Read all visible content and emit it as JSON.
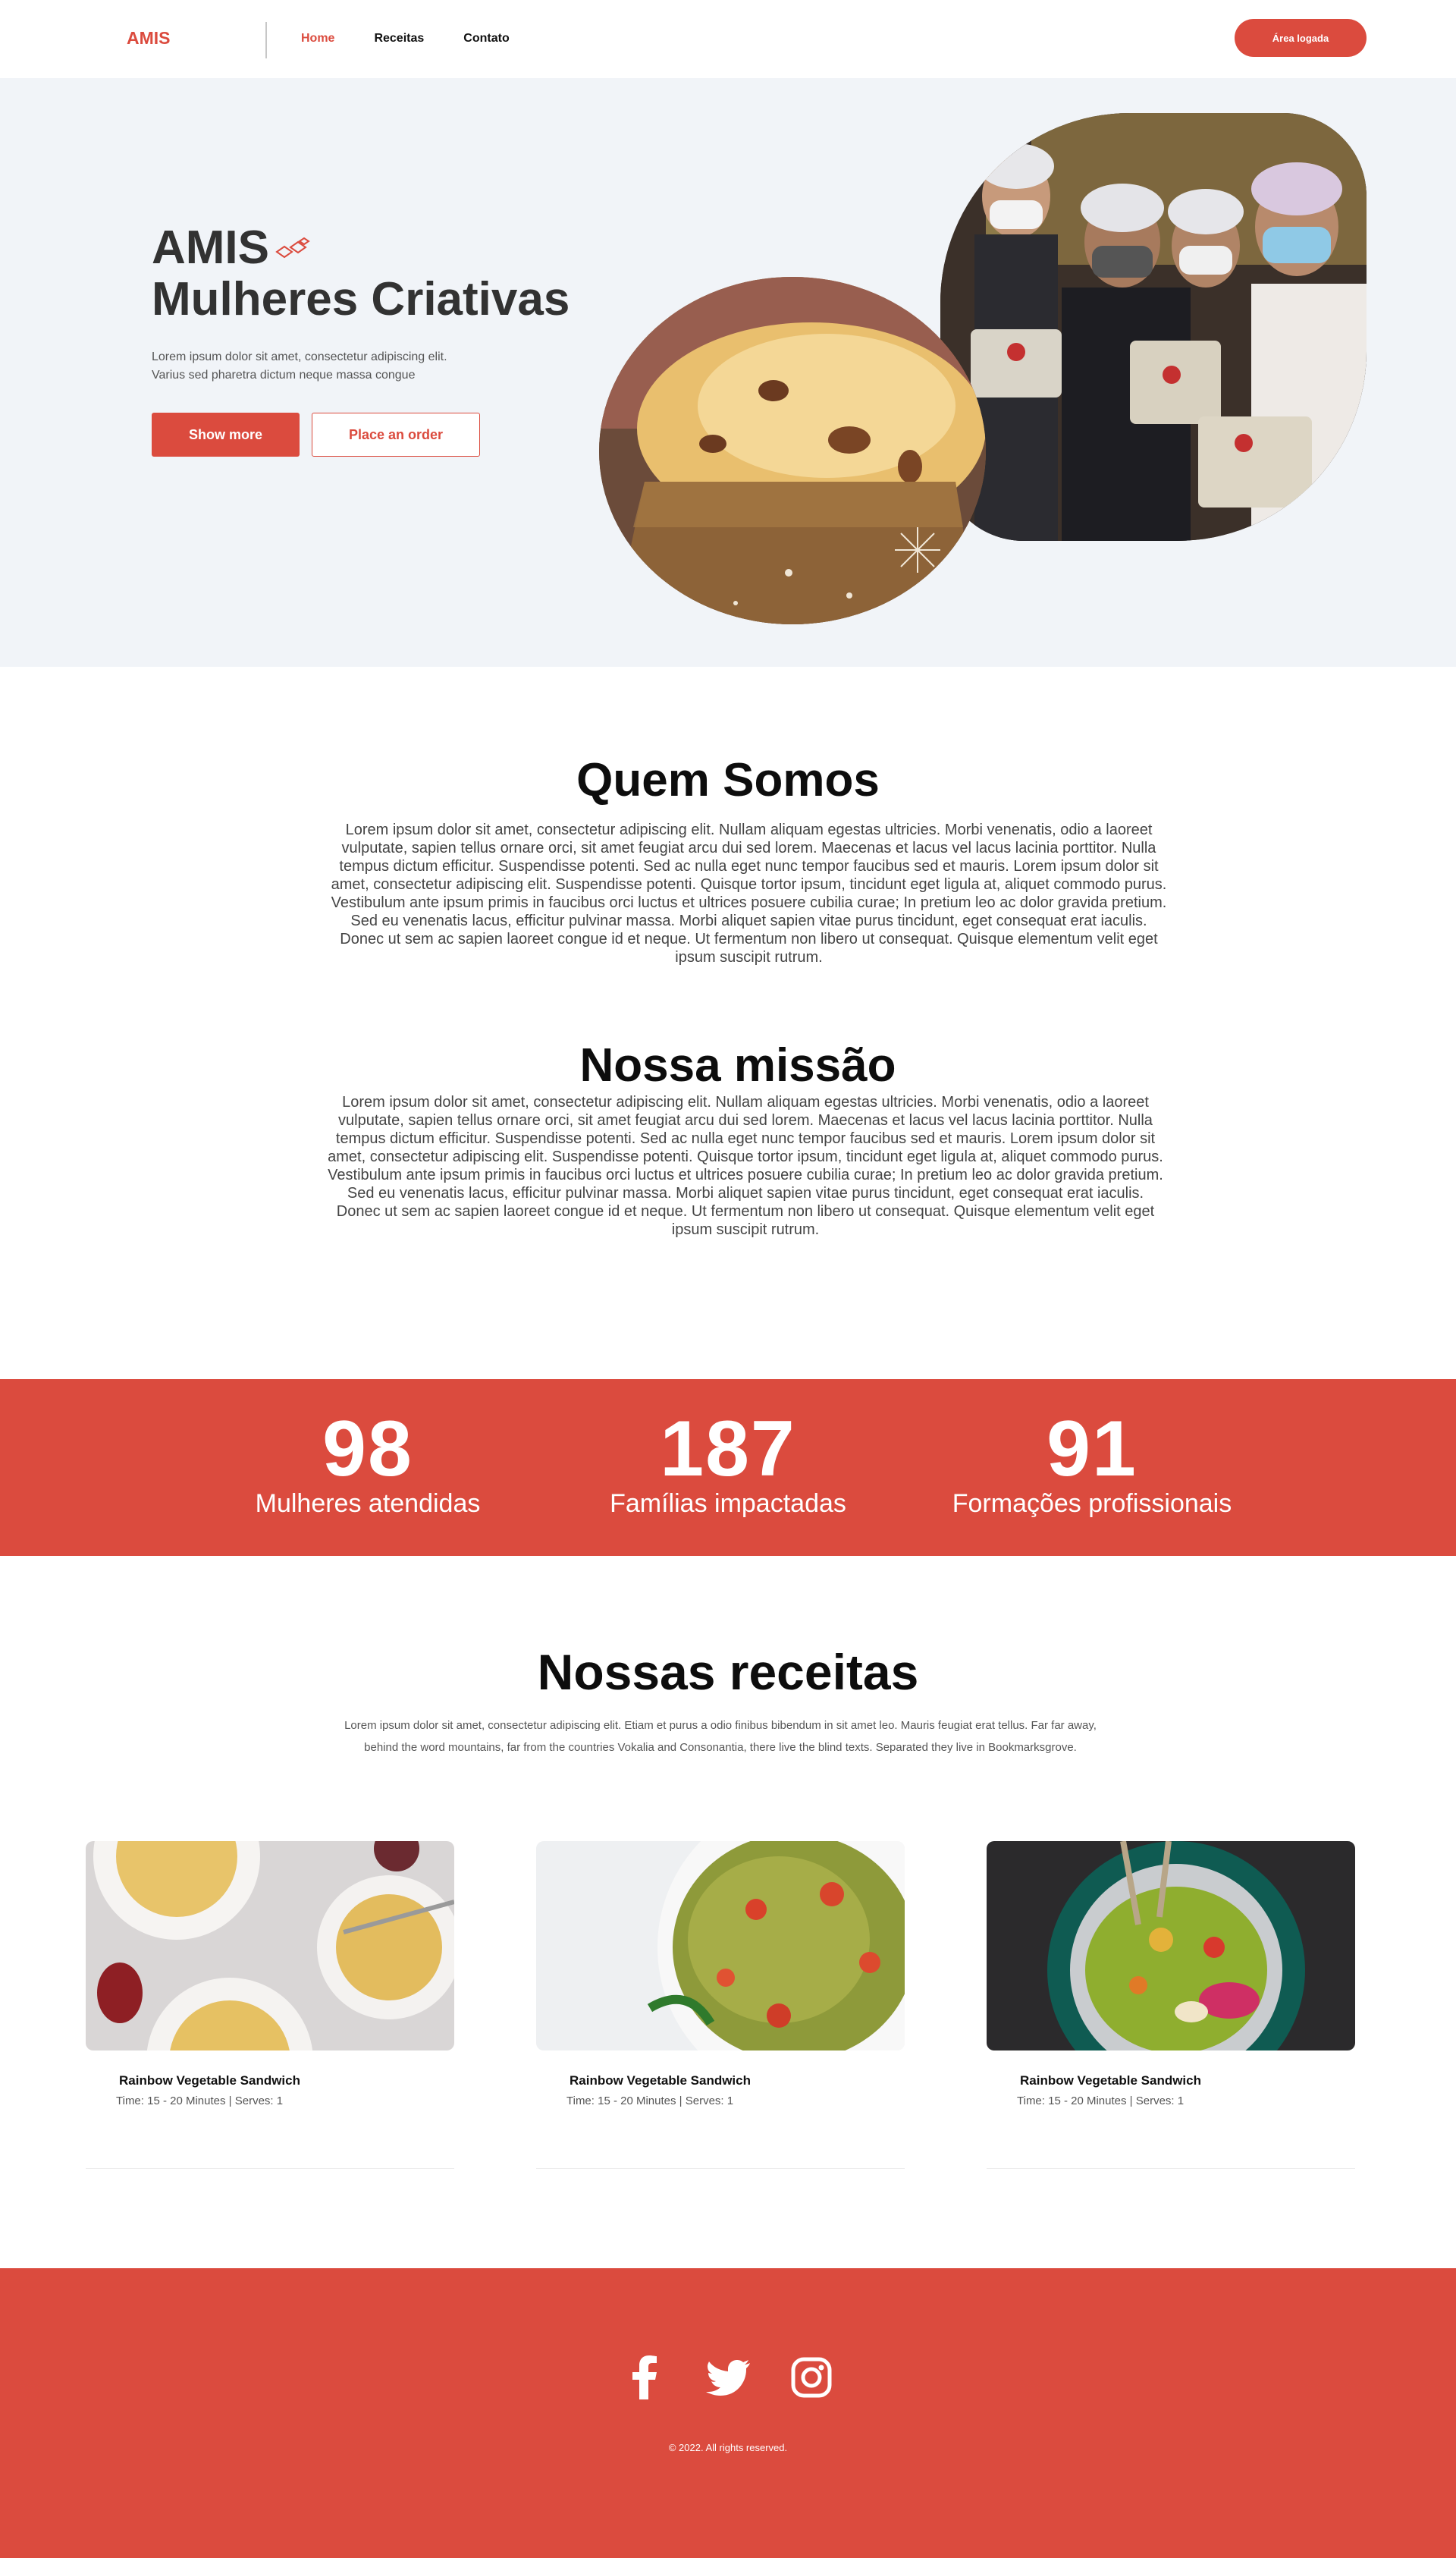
{
  "nav": {
    "logo": "AMIS",
    "links": [
      "Home",
      "Receitas",
      "Contato"
    ],
    "login_label": "Área logada"
  },
  "hero": {
    "title_line1": "AMIS",
    "title_line2": "Mulheres Criativas",
    "lead_line1": "Lorem ipsum dolor sit amet, consectetur adipiscing elit.",
    "lead_line2": "Varius sed pharetra dictum neque massa congue",
    "primary_button": "Show more",
    "secondary_button": "Place an order"
  },
  "about": {
    "title": "Quem Somos",
    "text": "Lorem ipsum dolor sit amet, consectetur adipiscing elit. Nullam aliquam egestas ultricies. Morbi venenatis, odio a laoreet vulputate, sapien tellus ornare orci, sit amet feugiat arcu dui sed lorem. Maecenas et lacus vel lacus lacinia porttitor. Nulla tempus dictum efficitur. Suspendisse potenti. Sed ac nulla eget nunc tempor faucibus sed et mauris. Lorem ipsum dolor sit amet, consectetur adipiscing elit. Suspendisse potenti. Quisque tortor ipsum, tincidunt eget ligula at, aliquet commodo purus. Vestibulum ante ipsum primis in faucibus orci luctus et ultrices posuere cubilia curae; In pretium leo ac dolor gravida pretium. Sed eu venenatis lacus, efficitur pulvinar massa. Morbi aliquet sapien vitae purus tincidunt, eget consequat erat iaculis. Donec ut sem ac sapien laoreet congue id et neque. Ut fermentum non libero ut consequat. Quisque elementum velit eget ipsum suscipit rutrum."
  },
  "mission": {
    "title": "Nossa missão",
    "text": "Lorem ipsum dolor sit amet, consectetur adipiscing elit. Nullam aliquam egestas ultricies. Morbi venenatis, odio a laoreet vulputate, sapien tellus ornare orci, sit amet feugiat arcu dui sed lorem. Maecenas et lacus vel lacus lacinia porttitor. Nulla tempus dictum efficitur. Suspendisse potenti. Sed ac nulla eget nunc tempor faucibus sed et mauris. Lorem ipsum dolor sit amet, consectetur adipiscing elit. Suspendisse potenti. Quisque tortor ipsum, tincidunt eget ligula at, aliquet commodo purus. Vestibulum ante ipsum primis in faucibus orci luctus et ultrices posuere cubilia curae; In pretium leo ac dolor gravida pretium. Sed eu venenatis lacus, efficitur pulvinar massa. Morbi aliquet sapien vitae purus tincidunt, eget consequat erat iaculis. Donec ut sem ac sapien laoreet congue id et neque. Ut fermentum non libero ut consequat. Quisque elementum velit eget ipsum suscipit rutrum."
  },
  "stats": [
    {
      "number": "98",
      "label": "Mulheres atendidas"
    },
    {
      "number": "187",
      "label": "Famílias impactadas"
    },
    {
      "number": "91",
      "label": "Formações profissionais"
    }
  ],
  "recipes": {
    "title": "Nossas receitas",
    "lead": "Lorem ipsum dolor sit amet, consectetur adipiscing elit. Etiam et purus a odio finibus bibendum in sit amet leo. Mauris feugiat erat tellus. Far far away, behind the word mountains, far from the countries Vokalia and Consonantia, there live the blind texts. Separated they live in Bookmarksgrove.",
    "cards": [
      {
        "title": "Rainbow Vegetable Sandwich",
        "meta": "Time: 15 - 20 Minutes | Serves: 1"
      },
      {
        "title": "Rainbow Vegetable Sandwich",
        "meta": "Time: 15 - 20 Minutes | Serves: 1"
      },
      {
        "title": "Rainbow Vegetable Sandwich",
        "meta": "Time: 15 - 20 Minutes | Serves: 1"
      }
    ]
  },
  "footer": {
    "social_icons": [
      "facebook-icon",
      "twitter-icon",
      "instagram-icon"
    ],
    "copyright": "© 2022. All rights reserved."
  },
  "colors": {
    "accent": "#db4b3e",
    "hero_bg": "#f1f4f8"
  }
}
